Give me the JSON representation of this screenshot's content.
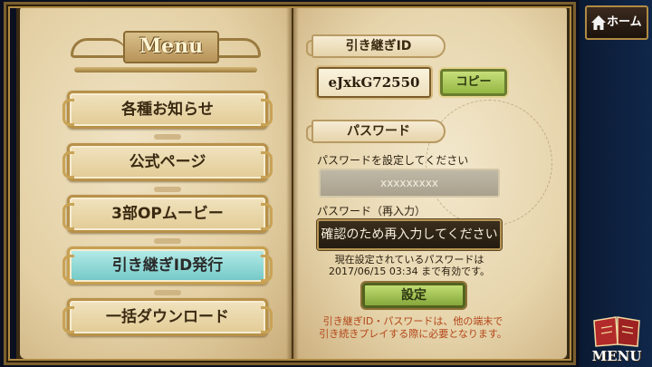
{
  "menu": {
    "title": "Menu",
    "items": [
      {
        "label": "各種お知らせ",
        "active": false
      },
      {
        "label": "公式ページ",
        "active": false
      },
      {
        "label": "3部OPムービー",
        "active": false
      },
      {
        "label": "引き継ぎID発行",
        "active": true
      },
      {
        "label": "一括ダウンロード",
        "active": false
      }
    ]
  },
  "transfer": {
    "id_section_label": "引き継ぎID",
    "id_value": "eJxkG72550",
    "copy_label": "コピー",
    "password_section_label": "パスワード",
    "password_hint": "パスワードを設定してください",
    "password_masked": "xxxxxxxxx",
    "confirm_label": "パスワード（再入力）",
    "confirm_placeholder": "確認のため再入力してください",
    "info_line1": "現在設定されているパスワードは",
    "info_line2": "2017/06/15 03:34 まで有効です。",
    "set_label": "設定",
    "note_line1": "引き継ぎID・パスワードは、他の端末で",
    "note_line2": "引き続きプレイする際に必要となります。"
  },
  "nav": {
    "home_label": "ホーム",
    "menu_label": "MENU"
  },
  "colors": {
    "accent_green": "#94b743",
    "active_cyan": "#71c7c6",
    "note_orange": "#b3471a"
  }
}
